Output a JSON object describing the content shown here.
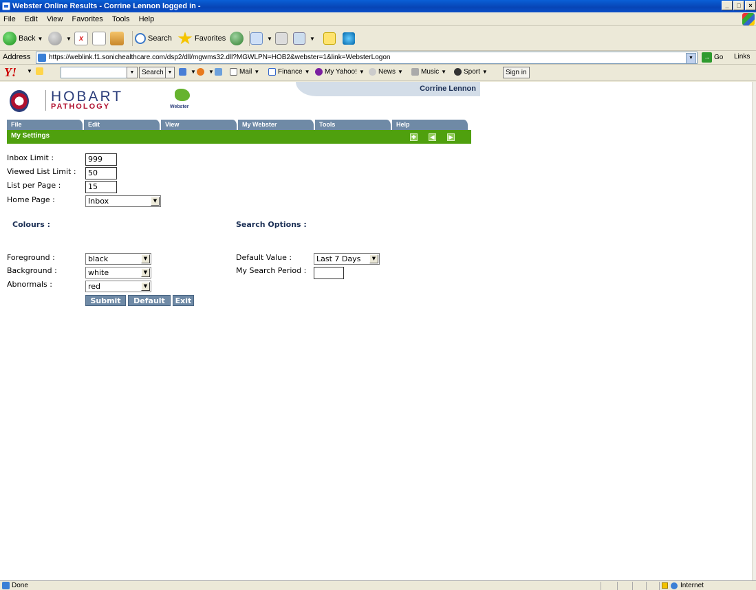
{
  "window": {
    "title": "Webster Online Results - Corrine Lennon logged in -"
  },
  "menubar": {
    "items": [
      "File",
      "Edit",
      "View",
      "Favorites",
      "Tools",
      "Help"
    ]
  },
  "toolbar": {
    "back_label": "Back",
    "search_label": "Search",
    "favorites_label": "Favorites"
  },
  "address": {
    "label": "Address",
    "url": "https://weblink.f1.sonichealthcare.com/dsp2/dll/mgwms32.dll?MGWLPN=HOB2&webster=1&link=WebsterLogon",
    "go_label": "Go",
    "links_label": "Links"
  },
  "yahoo": {
    "logo": "Y!",
    "search_btn": "Search",
    "mail": "Mail",
    "finance": "Finance",
    "my_yahoo": "My Yahoo!",
    "news": "News",
    "music": "Music",
    "sport": "Sport",
    "sign_in": "Sign in"
  },
  "app": {
    "user_name": "Corrine Lennon",
    "brand_line1": "HOBART",
    "brand_line2": "PATHOLOGY",
    "webster_logo_text": "Webster",
    "nav": [
      "File",
      "Edit",
      "View",
      "My Webster",
      "Tools",
      "Help"
    ],
    "section_title": "My Settings"
  },
  "settings": {
    "inbox_limit_label": "Inbox Limit :",
    "inbox_limit_value": "999",
    "viewed_list_limit_label": "Viewed List Limit :",
    "viewed_list_limit_value": "50",
    "list_per_page_label": "List per Page :",
    "list_per_page_value": "15",
    "home_page_label": "Home Page :",
    "home_page_value": "Inbox"
  },
  "colours": {
    "heading": "Colours :",
    "foreground_label": "Foreground :",
    "foreground_value": "black",
    "background_label": "Background :",
    "background_value": "white",
    "abnormals_label": "Abnormals :",
    "abnormals_value": "red"
  },
  "search_options": {
    "heading": "Search Options :",
    "default_value_label": "Default Value :",
    "default_value_value": "Last 7 Days",
    "my_search_period_label": "My Search Period :",
    "my_search_period_value": ""
  },
  "buttons": {
    "submit": "Submit",
    "default": "Default",
    "exit": "Exit"
  },
  "status": {
    "text": "Done",
    "zone": "Internet"
  },
  "colors": {
    "accent_green": "#4fa00e",
    "nav_blue": "#6f8aa6",
    "brand_navy": "#2a3c7a",
    "brand_red": "#b0102f"
  }
}
